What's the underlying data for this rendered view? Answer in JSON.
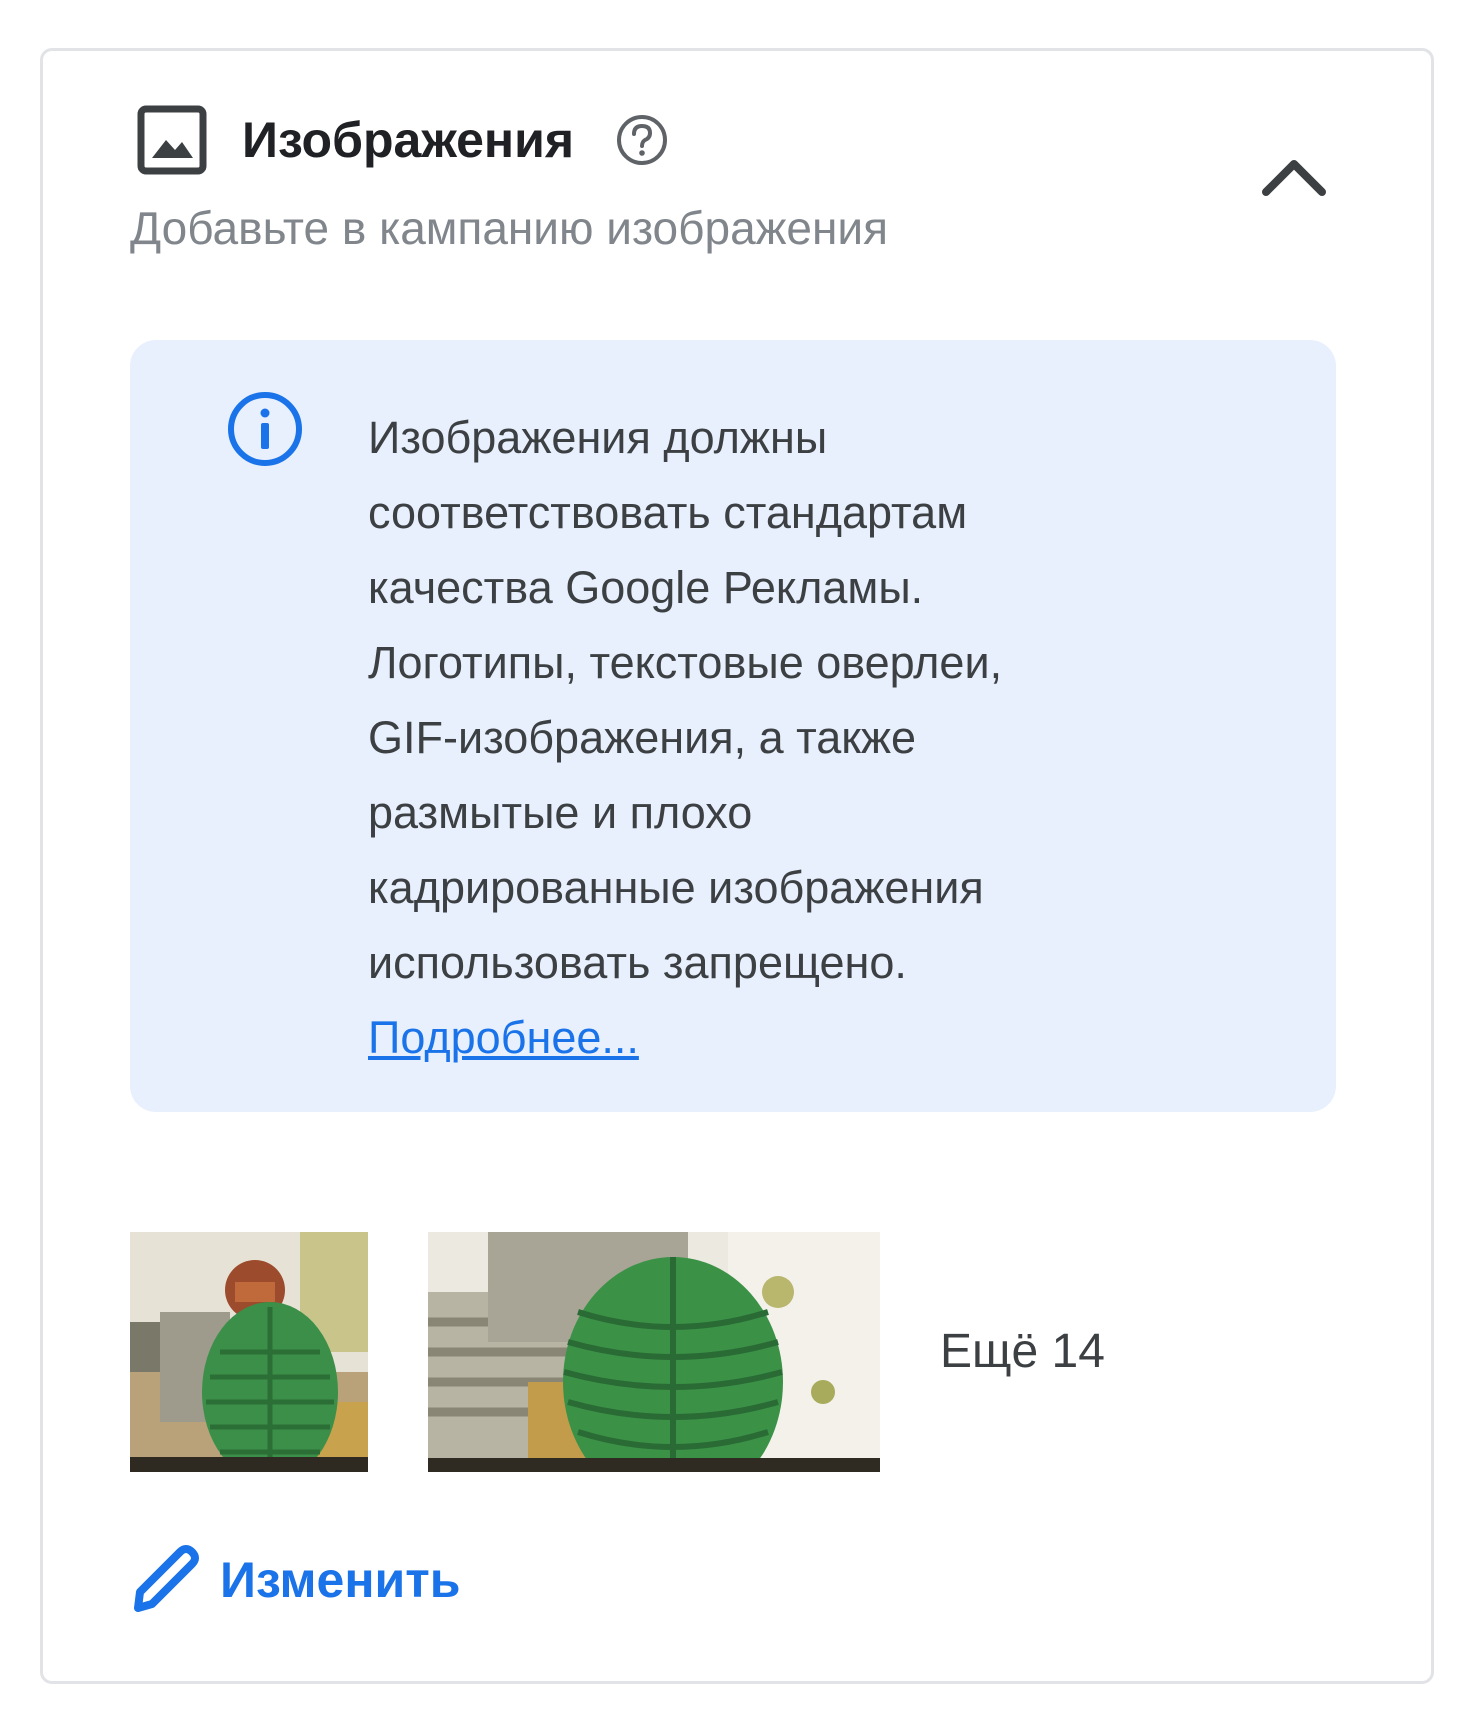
{
  "section": {
    "title": "Изображения",
    "subtitle": "Добавьте в кампанию изображения",
    "header_icon": "image-icon",
    "help_icon": "help-circle-icon",
    "collapse_icon": "chevron-up-icon"
  },
  "notice": {
    "icon": "info-icon",
    "lines": [
      "Изображения должны",
      "соответствовать стандартам",
      "качества Google Рекламы.",
      "Логотипы, текстовые оверлеи,",
      "GIF-изображения, а также",
      "размытые и плохо",
      "кадрированные изображения",
      "использовать запрещено."
    ],
    "link": "Подробнее..."
  },
  "images": {
    "more_label": "Ещё 14"
  },
  "edit": {
    "icon": "pencil-icon",
    "label": "Изменить"
  },
  "colors": {
    "accent": "#1a73e8",
    "notice_bg": "#e8f0fe",
    "text": "#3c4043",
    "muted": "#80868b"
  }
}
